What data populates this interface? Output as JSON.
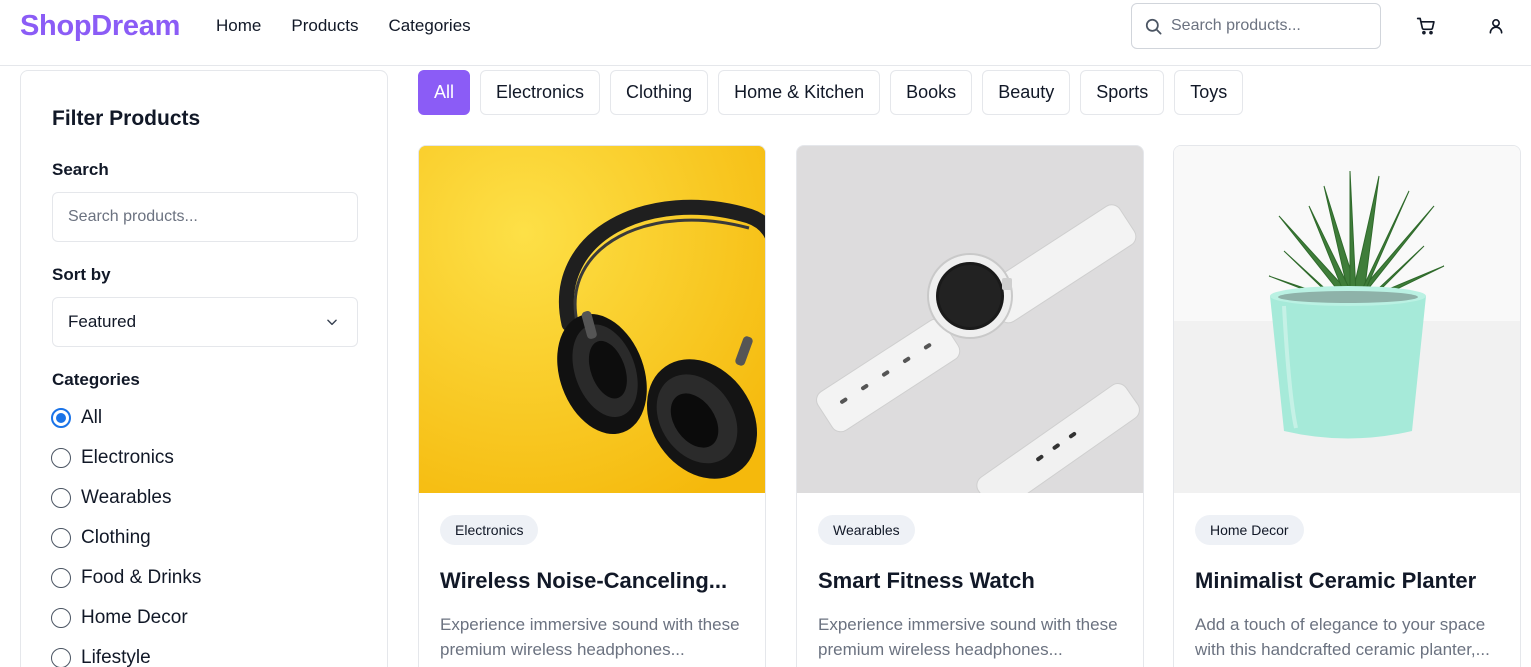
{
  "header": {
    "brand": "ShopDream",
    "nav": [
      "Home",
      "Products",
      "Categories"
    ],
    "search_placeholder": "Search products..."
  },
  "sidebar": {
    "title": "Filter Products",
    "search_label": "Search",
    "search_placeholder": "Search products...",
    "sort_label": "Sort by",
    "sort_value": "Featured",
    "categories_label": "Categories",
    "categories": [
      {
        "label": "All",
        "checked": true
      },
      {
        "label": "Electronics",
        "checked": false
      },
      {
        "label": "Wearables",
        "checked": false
      },
      {
        "label": "Clothing",
        "checked": false
      },
      {
        "label": "Food & Drinks",
        "checked": false
      },
      {
        "label": "Home Decor",
        "checked": false
      },
      {
        "label": "Lifestyle",
        "checked": false
      }
    ]
  },
  "tabs": [
    {
      "label": "All",
      "active": true
    },
    {
      "label": "Electronics",
      "active": false
    },
    {
      "label": "Clothing",
      "active": false
    },
    {
      "label": "Home & Kitchen",
      "active": false
    },
    {
      "label": "Books",
      "active": false
    },
    {
      "label": "Beauty",
      "active": false
    },
    {
      "label": "Sports",
      "active": false
    },
    {
      "label": "Toys",
      "active": false
    }
  ],
  "products": [
    {
      "category": "Electronics",
      "name": "Wireless Noise-Canceling...",
      "description": "Experience immersive sound with these premium wireless headphones..."
    },
    {
      "category": "Wearables",
      "name": "Smart Fitness Watch",
      "description": "Experience immersive sound with these premium wireless headphones..."
    },
    {
      "category": "Home Decor",
      "name": "Minimalist Ceramic Planter",
      "description": "Add a touch of elegance to your space with this handcrafted ceramic planter,..."
    }
  ],
  "colors": {
    "brand": "#8b5cf6",
    "radio_accent": "#1a73e8",
    "headphones_bg": "#f7c823",
    "watch_bg": "#dcdcdc"
  },
  "icons": [
    "search-icon",
    "cart-icon",
    "user-icon",
    "chevron-down-icon"
  ]
}
